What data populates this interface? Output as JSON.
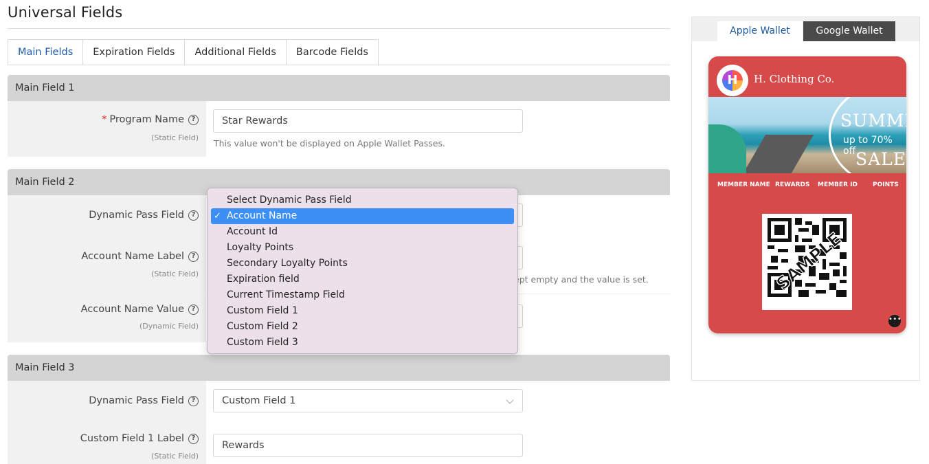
{
  "page": {
    "title": "Universal Fields"
  },
  "tabs": [
    {
      "label": "Main Fields",
      "active": true
    },
    {
      "label": "Expiration Fields"
    },
    {
      "label": "Additional Fields"
    },
    {
      "label": "Barcode Fields"
    }
  ],
  "main_field_1": {
    "heading": "Main Field 1",
    "program_name": {
      "label": "Program Name",
      "sublabel": "(Static Field)",
      "value": "Star Rewards",
      "help": "This value won't be displayed on Apple Wallet Passes."
    }
  },
  "main_field_2": {
    "heading": "Main Field 2",
    "dynamic_pass_field": {
      "label": "Dynamic Pass Field"
    },
    "account_name_label": {
      "label": "Account Name Label",
      "sublabel": "(Static Field)",
      "help_tail": "ept empty and the value is set."
    },
    "account_name_value": {
      "label": "Account Name Value",
      "sublabel": "(Dynamic Field)"
    }
  },
  "dropdown": {
    "options": [
      "Select Dynamic Pass Field",
      "Account Name",
      "Account Id",
      "Loyalty Points",
      "Secondary Loyalty Points",
      "Expiration field",
      "Current Timestamp Field",
      "Custom Field 1",
      "Custom Field 2",
      "Custom Field 3"
    ],
    "selected": "Account Name"
  },
  "main_field_3": {
    "heading": "Main Field 3",
    "dynamic_pass_field": {
      "label": "Dynamic Pass Field",
      "value": "Custom Field 1"
    },
    "custom_field_label": {
      "label": "Custom Field 1 Label",
      "sublabel": "(Static Field)",
      "value": "Rewards"
    }
  },
  "preview": {
    "tabs": {
      "apple": "Apple Wallet",
      "google": "Google Wallet"
    },
    "card": {
      "logo_letter": "H",
      "brand": "H. Clothing Co.",
      "banner": {
        "top": "SUMMER",
        "mid": "up to 70% off",
        "bottom": "SALE"
      },
      "fields": [
        "MEMBER NAME",
        "REWARDS",
        "MEMBER ID",
        "POINTS"
      ],
      "color": "#d64a4a"
    }
  },
  "colors": {
    "accent": "#1f5aa6",
    "required": "#dd2222",
    "selected_option": "#3d8ff5"
  }
}
